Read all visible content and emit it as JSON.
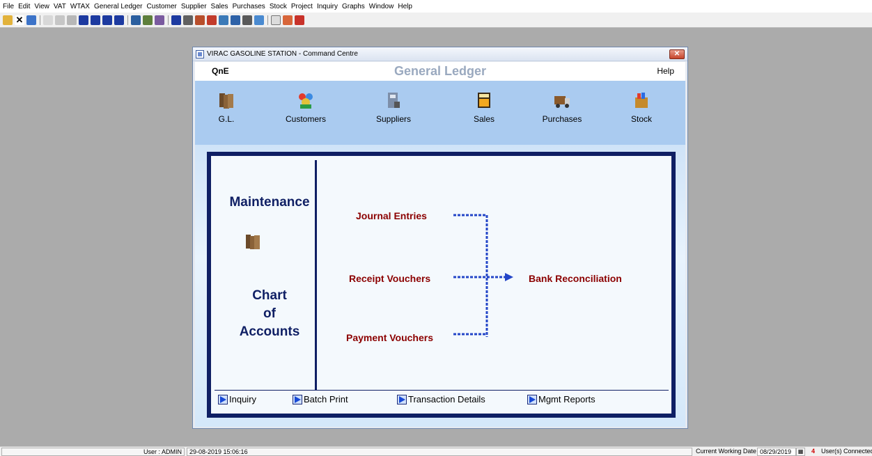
{
  "menu": [
    "File",
    "Edit",
    "View",
    "VAT",
    "WTAX",
    "General Ledger",
    "Customer",
    "Supplier",
    "Sales",
    "Purchases",
    "Stock",
    "Project",
    "Inquiry",
    "Graphs",
    "Window",
    "Help"
  ],
  "window": {
    "title": "VIRAC GASOLINE STATION - Command Centre",
    "close_label": "✕",
    "brand": "QnE",
    "heading": "General Ledger",
    "help_label": "Help"
  },
  "modules": [
    {
      "label": "G.L.",
      "icon": "folders-icon"
    },
    {
      "label": "Customers",
      "icon": "customers-icon"
    },
    {
      "label": "Suppliers",
      "icon": "suppliers-icon"
    },
    {
      "label": "Sales",
      "icon": "calculator-icon"
    },
    {
      "label": "Purchases",
      "icon": "truck-icon"
    },
    {
      "label": "Stock",
      "icon": "stock-box-icon"
    }
  ],
  "panel": {
    "maintenance": "Maintenance",
    "chart_line1": "Chart",
    "chart_line2": "of",
    "chart_line3": "Accounts",
    "journal_entries": "Journal Entries",
    "receipt_vouchers": "Receipt Vouchers",
    "payment_vouchers": "Payment Vouchers",
    "bank_reconciliation": "Bank Reconciliation"
  },
  "bottom_links": [
    "Inquiry",
    "Batch Print",
    "Transaction Details",
    "Mgmt Reports"
  ],
  "status": {
    "user": "User : ADMIN",
    "datetime": "29-08-2019 15:06:16",
    "working_date_label": "Current Working Date :",
    "working_date": "08/29/2019",
    "users_count": "4",
    "users_label": "User(s) Connected."
  },
  "colors": {
    "panel_border": "#0f1f64",
    "link_red": "#8b0000",
    "module_band": "#aacbf0",
    "connector": "#2446c8"
  }
}
